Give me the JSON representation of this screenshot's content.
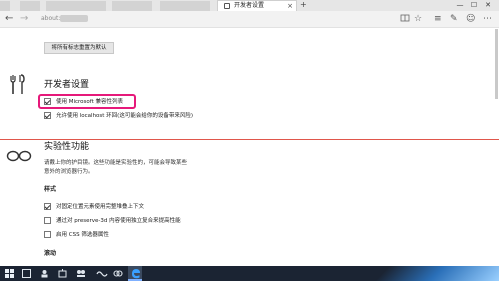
{
  "browser": {
    "tab_title": "开发者设置",
    "tab_close": "×",
    "new_tab": "+",
    "url_text": "about:flags",
    "window_controls": [
      "—",
      "☐",
      "✕"
    ],
    "nav": {
      "back": "←",
      "forward": "→"
    },
    "address_icons": [
      "☆",
      "≡",
      "✎",
      "☺",
      "⋯"
    ]
  },
  "reset_button": "将所有标志重置为默认",
  "developer": {
    "title": "开发者设置",
    "options": [
      {
        "label": "使用 Microsoft 兼容性列表",
        "checked": true,
        "highlighted": true
      },
      {
        "label": "允许使用 localhost 环回(这可能会给你的设备带来风险)",
        "checked": true
      }
    ]
  },
  "experimental": {
    "title": "实验性功能",
    "description": [
      "请戴上你的护目镜。这些功能是实验性的，可能会导致某些",
      "意外的浏览器行为。"
    ],
    "style_heading": "样式",
    "options": [
      {
        "label": "对固定位置元素使用完整堆叠上下文",
        "checked": true
      },
      {
        "label": "通过对 preserve-3d 内容使用独立复合来提高性能",
        "checked": false
      },
      {
        "label": "启用 CSS 筛选器属性",
        "checked": false
      }
    ],
    "scroll_heading": "滚动"
  },
  "colors": {
    "highlight": "#e6197a",
    "divider": "#e0564b",
    "taskbar": "#1b2433"
  },
  "taskbar": {
    "icons": [
      "windows-logo-icon",
      "search-icon",
      "task-view-icon",
      "store-icon",
      "people-icon",
      "network-icon",
      "edge-icon"
    ]
  }
}
